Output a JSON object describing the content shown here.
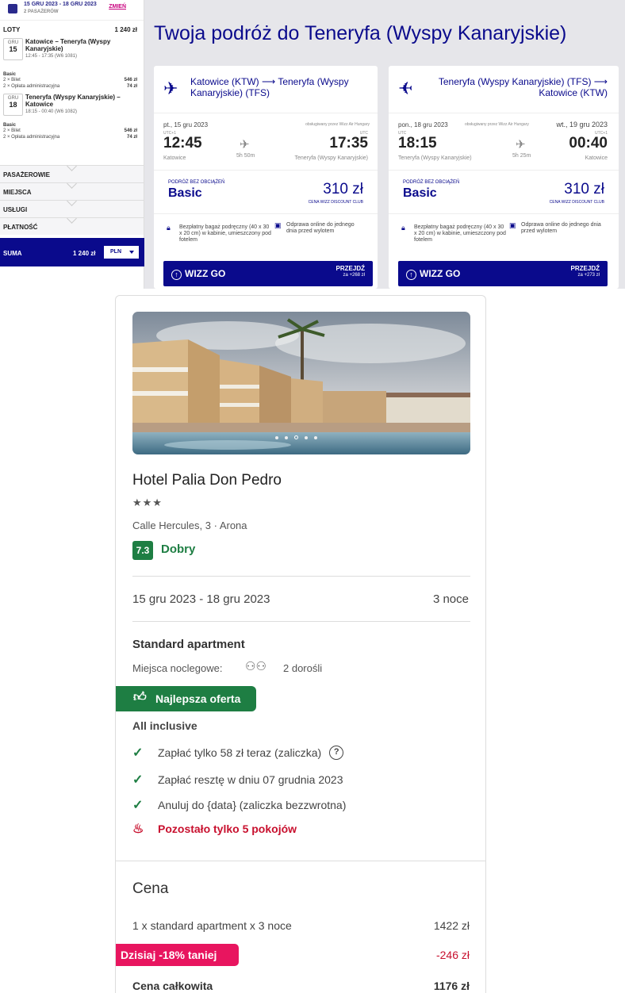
{
  "sidebar": {
    "dates": "15 GRU 2023 - 18 GRU 2023",
    "passengers": "2 PASAŻERÓW",
    "change": "ZMIEŃ",
    "flights_label": "LOTY",
    "flights_total": "1 240 zł",
    "flights": [
      {
        "month": "GRU",
        "day": "15",
        "route": "Katowice – Teneryfa (Wyspy Kanaryjskie)",
        "meta": "12:45 - 17:35 (W6 1081)",
        "fare": "Basic",
        "lines": [
          {
            "label": "2 × Bilet",
            "value": "546 zł"
          },
          {
            "label": "2 × Opłata administracyjna",
            "value": "74 zł"
          }
        ]
      },
      {
        "month": "GRU",
        "day": "18",
        "route": "Teneryfa (Wyspy Kanaryjskie) – Katowice",
        "meta": "18:15 - 00:40 (W6 1082)",
        "fare": "Basic",
        "lines": [
          {
            "label": "2 × Bilet",
            "value": "546 zł"
          },
          {
            "label": "2 × Opłata administracyjna",
            "value": "74 zł"
          }
        ]
      }
    ],
    "sections": [
      "PASAŻEROWIE",
      "MIEJSCA",
      "USŁUGI",
      "PŁATNOŚĆ"
    ],
    "total_label": "SUMA",
    "total_value": "1 240 zł",
    "currency": "PLN"
  },
  "trip_title": "Twoja podróż do Teneryfa (Wyspy Kanaryjskie)",
  "cards": [
    {
      "route": "Katowice (KTW) ⟶ Teneryfa (Wyspy Kanaryjskie) (TFS)",
      "dep_date": "pt., 15 gru 2023",
      "operated": "obsługiwany przez Wizz Air Hungary",
      "dep_utc": "UTC+1",
      "arr_utc": "UTC",
      "dep_time": "12:45",
      "arr_time": "17:35",
      "duration": "5h 50m",
      "dep_place": "Katowice",
      "arr_place": "Teneryfa (Wyspy Kanaryjskie)",
      "fare_tag": "PODRÓŻ BEZ OBCIĄŻEŃ",
      "fare_name": "Basic",
      "price": "310 zł",
      "club": "CENA WIZZ DISCOUNT CLUB",
      "feat_bag": "Bezpłatny bagaż podręczny (40 x 30 x 20 cm) w kabinie, umieszczony pod fotelem",
      "feat_checkin": "Odprawa online do jednego dnia przed wylotem",
      "go": "WIZZ GO",
      "go_cta": "PRZEJDŹ",
      "go_price": "za +268 zł"
    },
    {
      "route": "Teneryfa (Wyspy Kanaryjskie) (TFS) ⟶ Katowice (KTW)",
      "dep_date": "pon., 18 gru 2023",
      "operated": "obsługiwany przez Wizz Air Hungary",
      "arr_date": "wt., 19 gru 2023",
      "dep_utc": "UTC",
      "arr_utc": "UTC+1",
      "dep_time": "18:15",
      "arr_time": "00:40",
      "duration": "5h 25m",
      "dep_place": "Teneryfa (Wyspy Kanaryjskie)",
      "arr_place": "Katowice",
      "fare_tag": "PODRÓŻ BEZ OBCIĄŻEŃ",
      "fare_name": "Basic",
      "price": "310 zł",
      "club": "CENA WIZZ DISCOUNT CLUB",
      "feat_bag": "Bezpłatny bagaż podręczny (40 x 30 x 20 cm) w kabinie, umieszczony pod fotelem",
      "feat_checkin": "Odprawa online do jednego dnia przed wylotem",
      "go": "WIZZ GO",
      "go_cta": "PRZEJDŹ",
      "go_price": "za +273 zł"
    }
  ],
  "hotel": {
    "name": "Hotel Palia Don Pedro",
    "stars": "★★★",
    "address": "Calle Hercules, 3 · Arona",
    "score": "7.3",
    "rating": "Dobry",
    "dates": "15 gru 2023 - 18 gru 2023",
    "nights": "3 noce",
    "room": "Standard apartment",
    "accommodation_label": "Miejsca noclegowe:",
    "adults": "2 dorośli",
    "best_offer": "Najlepsza oferta",
    "board": "All inclusive",
    "perks": [
      "Zapłać tylko 58 zł teraz (zaliczka)",
      "Zapłać resztę w dniu 07 grudnia 2023",
      "Anuluj do {data} (zaliczka bezzwrotna)"
    ],
    "rooms_left": "Pozostało tylko 5 pokojów",
    "price_title": "Cena",
    "price_line": "1 x standard apartment x 3 noce",
    "price_line_value": "1422 zł",
    "discount": "Dzisiaj -18% taniej",
    "discount_value": "-246 zł",
    "total_label": "Cena całkowita",
    "total_value": "1176 zł",
    "photo_dots": 5,
    "photo_active_dot": 3
  },
  "colors": {
    "wizz_blue": "#0a0a8c",
    "wizz_pink": "#c8007e",
    "green": "#1e7e43",
    "red": "#c8102e",
    "discount_pink": "#e8155f"
  }
}
